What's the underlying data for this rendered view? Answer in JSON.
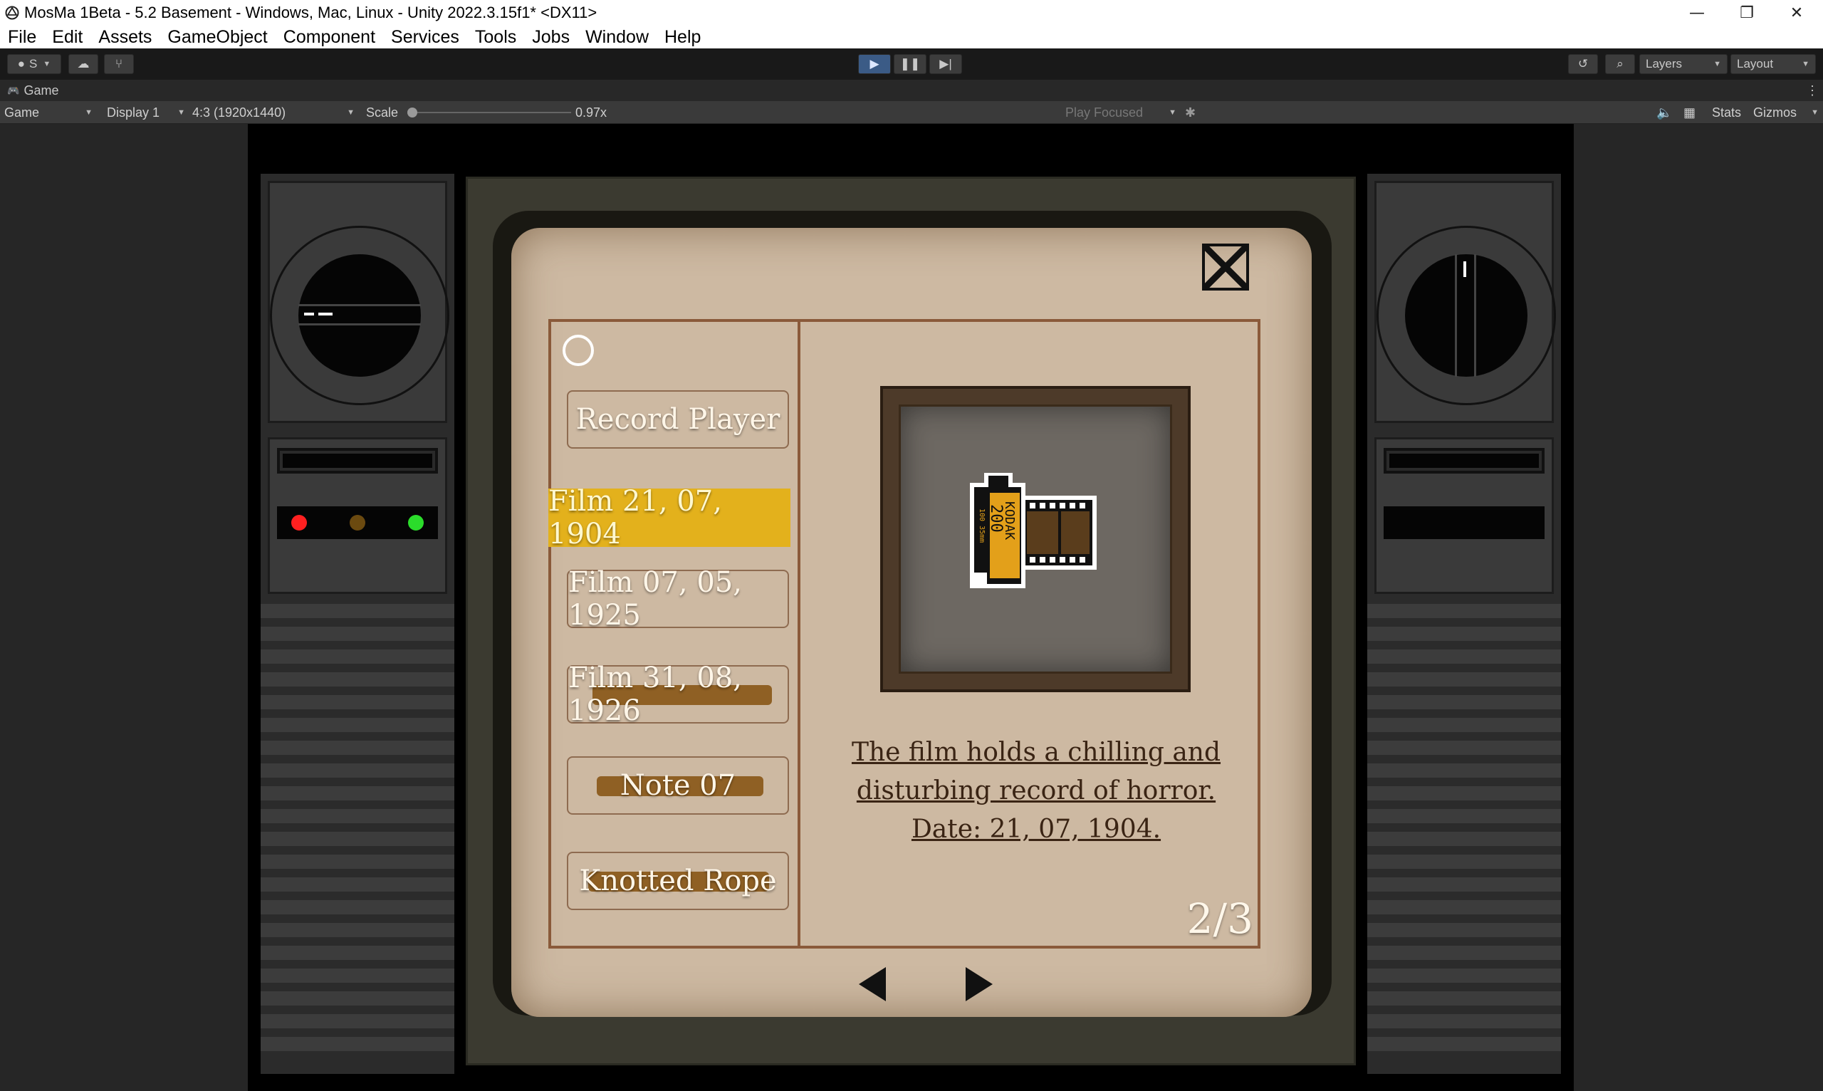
{
  "window": {
    "title": "MosMa 1Beta - 5.2 Basement - Windows, Mac, Linux - Unity 2022.3.15f1* <DX11>",
    "minimize": "—",
    "maximize": "❐",
    "close": "✕"
  },
  "menubar": {
    "items": [
      "File",
      "Edit",
      "Assets",
      "GameObject",
      "Component",
      "Services",
      "Tools",
      "Jobs",
      "Window",
      "Help"
    ]
  },
  "toolbar": {
    "account_label": "S",
    "layers_label": "Layers",
    "layout_label": "Layout"
  },
  "game_view": {
    "tab_label": "Game",
    "mode_label": "Game",
    "display_label": "Display 1",
    "resolution_label": "4:3 (1920x1440)",
    "scale_label": "Scale",
    "scale_value": "0.97x",
    "play_focused_label": "Play Focused",
    "stats_label": "Stats",
    "gizmos_label": "Gizmos"
  },
  "inventory": {
    "items": [
      {
        "label": "Record Player"
      },
      {
        "label": "Film 21, 07, 1904"
      },
      {
        "label": "Film 07, 05, 1925"
      },
      {
        "label": "Film 31, 08, 1926"
      },
      {
        "label": "Note 07"
      },
      {
        "label": "Knotted Rope"
      }
    ],
    "selected_index": 1,
    "description_line1": "The film holds a chilling and",
    "description_line2": "disturbing record of horror.",
    "description_line3": "Date: 21, 07, 1904.",
    "page_counter": "2/3",
    "film_brand": "KODAK",
    "film_iso": "200",
    "film_side_text": "100 35mm",
    "highlight_color": "#e3b11c",
    "brush_color": "#8b5b1e"
  },
  "leds": {
    "colors": [
      "#ff2020",
      "#6b4a10",
      "#2bdc2b"
    ]
  }
}
